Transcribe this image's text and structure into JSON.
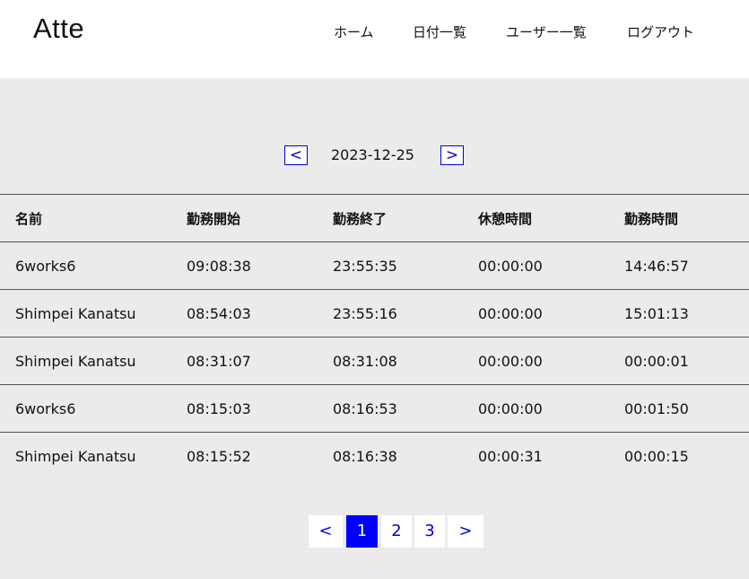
{
  "header": {
    "logo": "Atte",
    "nav": [
      {
        "label": "ホーム"
      },
      {
        "label": "日付一覧"
      },
      {
        "label": "ユーザー一覧"
      },
      {
        "label": "ログアウト"
      }
    ]
  },
  "date_nav": {
    "prev_label": "<",
    "date": "2023-12-25",
    "next_label": ">"
  },
  "table": {
    "headers": [
      "名前",
      "勤務開始",
      "勤務終了",
      "休憩時間",
      "勤務時間"
    ],
    "rows": [
      [
        "6works6",
        "09:08:38",
        "23:55:35",
        "00:00:00",
        "14:46:57"
      ],
      [
        "Shimpei Kanatsu",
        "08:54:03",
        "23:55:16",
        "00:00:00",
        "15:01:13"
      ],
      [
        "Shimpei Kanatsu",
        "08:31:07",
        "08:31:08",
        "00:00:00",
        "00:00:01"
      ],
      [
        "6works6",
        "08:15:03",
        "08:16:53",
        "00:00:00",
        "00:01:50"
      ],
      [
        "Shimpei Kanatsu",
        "08:15:52",
        "08:16:38",
        "00:00:31",
        "00:00:15"
      ]
    ]
  },
  "pagination": {
    "prev_label": "<",
    "pages": [
      "1",
      "2",
      "3"
    ],
    "active_page": "1",
    "next_label": ">"
  },
  "colors": {
    "accent": "#0000ff",
    "background": "#ebebeb",
    "header_bg": "#ffffff"
  }
}
